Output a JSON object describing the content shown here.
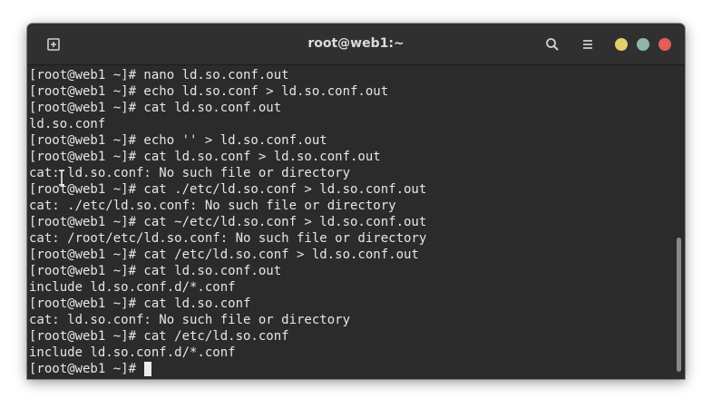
{
  "window": {
    "title": "root@web1:~"
  },
  "colors": {
    "background": "#2b2b2b",
    "titlebar": "#303030",
    "text": "#e6e6e6",
    "minimize": "#e3d06b",
    "maximize": "#8fb8a4",
    "close": "#e35d59"
  },
  "icons": {
    "new_tab": "new-tab-icon",
    "search": "search-icon",
    "menu": "hamburger-menu-icon"
  },
  "terminal": {
    "lines": [
      "[root@web1 ~]# nano ld.so.conf.out",
      "[root@web1 ~]# echo ld.so.conf > ld.so.conf.out",
      "[root@web1 ~]# cat ld.so.conf.out",
      "ld.so.conf",
      "[root@web1 ~]# echo '' > ld.so.conf.out",
      "[root@web1 ~]# cat ld.so.conf > ld.so.conf.out",
      "cat: ld.so.conf: No such file or directory",
      "[root@web1 ~]# cat ./etc/ld.so.conf > ld.so.conf.out",
      "cat: ./etc/ld.so.conf: No such file or directory",
      "[root@web1 ~]# cat ~/etc/ld.so.conf > ld.so.conf.out",
      "cat: /root/etc/ld.so.conf: No such file or directory",
      "[root@web1 ~]# cat /etc/ld.so.conf > ld.so.conf.out",
      "[root@web1 ~]# cat ld.so.conf.out",
      "include ld.so.conf.d/*.conf",
      "[root@web1 ~]# cat ld.so.conf",
      "cat: ld.so.conf: No such file or directory",
      "[root@web1 ~]# cat /etc/ld.so.conf",
      "include ld.so.conf.d/*.conf"
    ],
    "prompt": "[root@web1 ~]# "
  }
}
